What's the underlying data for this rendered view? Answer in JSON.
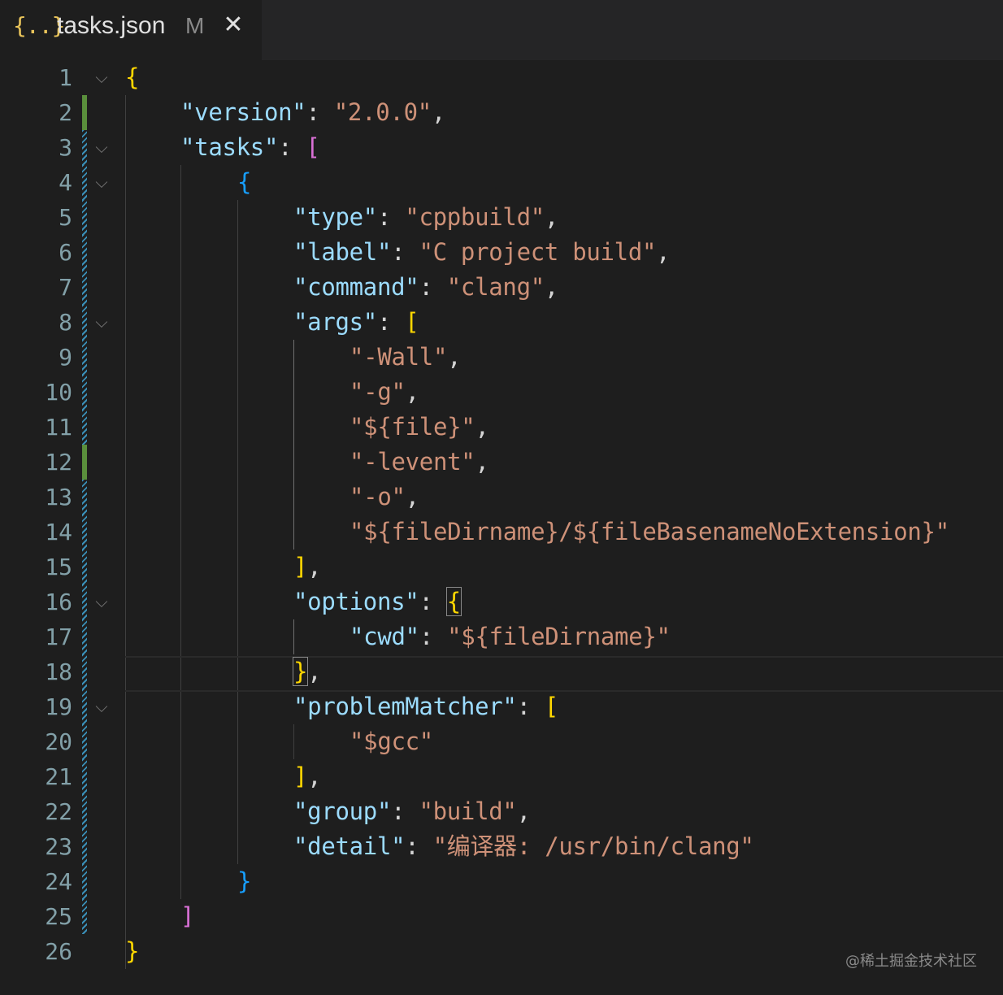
{
  "tab": {
    "icon": "{..}",
    "icon_name": "json-braces-icon",
    "title": "tasks.json",
    "status": "M",
    "close_glyph": "✕"
  },
  "fold_glyph": "⌵",
  "lines": [
    {
      "n": "1"
    },
    {
      "n": "2"
    },
    {
      "n": "3"
    },
    {
      "n": "4"
    },
    {
      "n": "5"
    },
    {
      "n": "6"
    },
    {
      "n": "7"
    },
    {
      "n": "8"
    },
    {
      "n": "9"
    },
    {
      "n": "10"
    },
    {
      "n": "11"
    },
    {
      "n": "12"
    },
    {
      "n": "13"
    },
    {
      "n": "14"
    },
    {
      "n": "15"
    },
    {
      "n": "16"
    },
    {
      "n": "17"
    },
    {
      "n": "18"
    },
    {
      "n": "19"
    },
    {
      "n": "20"
    },
    {
      "n": "21"
    },
    {
      "n": "22"
    },
    {
      "n": "23"
    },
    {
      "n": "24"
    },
    {
      "n": "25"
    },
    {
      "n": "26"
    }
  ],
  "code": {
    "l1_open": "{",
    "l2_key": "\"version\"",
    "l2_colon": ": ",
    "l2_val": "\"2.0.0\"",
    "l2_comma": ",",
    "l3_key": "\"tasks\"",
    "l3_colon": ": ",
    "l3_open": "[",
    "l4_open": "{",
    "l5_key": "\"type\"",
    "l5_colon": ": ",
    "l5_val": "\"cppbuild\"",
    "l5_comma": ",",
    "l6_key": "\"label\"",
    "l6_colon": ": ",
    "l6_val": "\"C project build\"",
    "l6_comma": ",",
    "l7_key": "\"command\"",
    "l7_colon": ": ",
    "l7_val": "\"clang\"",
    "l7_comma": ",",
    "l8_key": "\"args\"",
    "l8_colon": ": ",
    "l8_open": "[",
    "l9_val": "\"-Wall\"",
    "l9_comma": ",",
    "l10_val": "\"-g\"",
    "l10_comma": ",",
    "l11_val": "\"${file}\"",
    "l11_comma": ",",
    "l12_val": "\"-levent\"",
    "l12_comma": ",",
    "l13_val": "\"-o\"",
    "l13_comma": ",",
    "l14_val": "\"${fileDirname}/${fileBasenameNoExtension}\"",
    "l15_close": "]",
    "l15_comma": ",",
    "l16_key": "\"options\"",
    "l16_colon": ": ",
    "l16_open": "{",
    "l17_key": "\"cwd\"",
    "l17_colon": ": ",
    "l17_val": "\"${fileDirname}\"",
    "l18_close": "}",
    "l18_comma": ",",
    "l19_key": "\"problemMatcher\"",
    "l19_colon": ": ",
    "l19_open": "[",
    "l20_val": "\"$gcc\"",
    "l21_close": "]",
    "l21_comma": ",",
    "l22_key": "\"group\"",
    "l22_colon": ": ",
    "l22_val": "\"build\"",
    "l22_comma": ",",
    "l23_key": "\"detail\"",
    "l23_colon": ": ",
    "l23_val": "\"编译器: /usr/bin/clang\"",
    "l24_close": "}",
    "l25_close": "]",
    "l26_close": "}"
  },
  "colors": {
    "background": "#1e1e1e",
    "key": "#9cdcfe",
    "string": "#ce9178",
    "bracket_yellow": "#ffd700",
    "bracket_purple": "#da70d6",
    "bracket_blue": "#179fff",
    "line_number": "#82a0a8",
    "gutter_added": "#5a8f3c",
    "gutter_modified": "#3a8fb7"
  },
  "watermark": "@稀土掘金技术社区"
}
